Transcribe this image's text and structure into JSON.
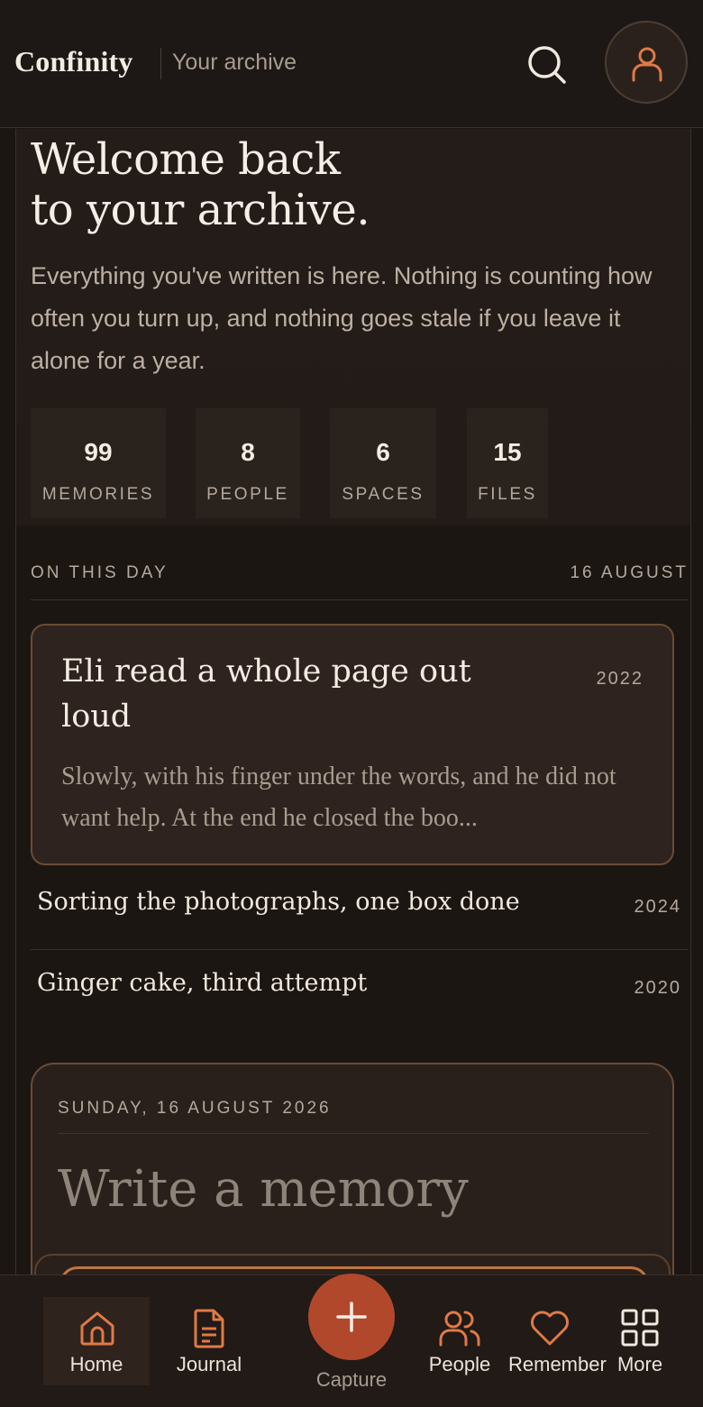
{
  "header": {
    "brand": "Confinity",
    "subtitle": "Your archive"
  },
  "hero": {
    "title_line1": "Welcome back",
    "title_line2": "to your archive.",
    "description": "Everything you've written is here. Nothing is counting how often you turn up, and nothing goes stale if you leave it alone for a year."
  },
  "stats": [
    {
      "value": "99",
      "label": "MEMORIES"
    },
    {
      "value": "8",
      "label": "PEOPLE"
    },
    {
      "value": "6",
      "label": "SPACES"
    },
    {
      "value": "15",
      "label": "FILES"
    }
  ],
  "on_this_day": {
    "label": "ON THIS DAY",
    "date": "16 AUGUST",
    "featured": {
      "title": "Eli read a whole page out loud",
      "year": "2022",
      "excerpt": "Slowly, with his finger under the words, and he did not want help. At the end he closed the boo..."
    },
    "memories": [
      {
        "title": "Sorting the photographs, one box done",
        "year": "2024"
      },
      {
        "title": "Ginger cake, third attempt",
        "year": "2020"
      }
    ]
  },
  "composer": {
    "date": "SUNDAY, 16 AUGUST 2026",
    "prompt": "Write a memory"
  },
  "nav": {
    "home": "Home",
    "journal": "Journal",
    "capture": "Capture",
    "people": "People",
    "remember": "Remember",
    "more": "More"
  },
  "colors": {
    "accent": "#e07a45",
    "capture": "#b2482b",
    "background": "#1c1613"
  }
}
